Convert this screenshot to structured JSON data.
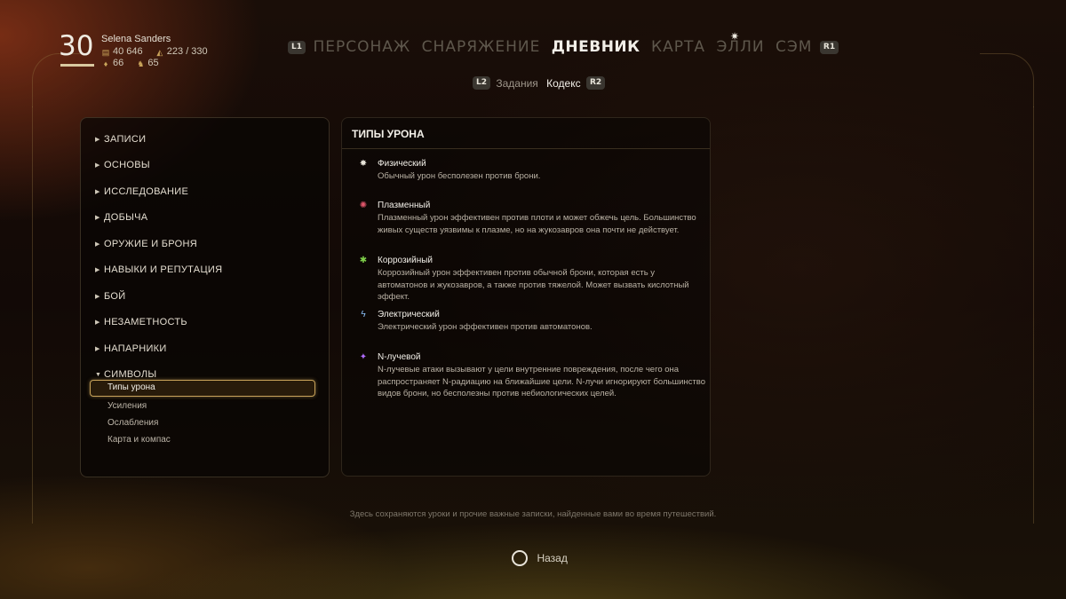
{
  "player": {
    "level": "30",
    "name": "Selena Sanders",
    "bits": "40 646",
    "carry": "223 / 330",
    "stat_a": "66",
    "stat_b": "65"
  },
  "tabs": {
    "hint_left": "L1",
    "hint_right": "R1",
    "items": [
      "ПЕРСОНАЖ",
      "СНАРЯЖЕНИЕ",
      "ДНЕВНИК",
      "КАРТА",
      "ЭЛЛИ",
      "СЭМ"
    ],
    "active": "ДНЕВНИК"
  },
  "subtabs": {
    "hint_left": "L2",
    "hint_right": "R2",
    "items": [
      "Задания",
      "Кодекс"
    ],
    "active": "Кодекс"
  },
  "categories": [
    "ЗАПИСИ",
    "ОСНОВЫ",
    "ИССЛЕДОВАНИЕ",
    "ДОБЫЧА",
    "ОРУЖИЕ И БРОНЯ",
    "НАВЫКИ И РЕПУТАЦИЯ",
    "БОЙ",
    "НЕЗАМЕТНОСТЬ",
    "НАПАРНИКИ",
    "СИМВОЛЫ"
  ],
  "subcategories": [
    "Типы урона",
    "Усиления",
    "Ослабления",
    "Карта и компас"
  ],
  "selected_subcategory": "Типы урона",
  "panel": {
    "title": "ТИПЫ УРОНА",
    "damage_types": [
      {
        "name": "Физический",
        "description": "Обычный урон бесполезен против брони.",
        "icon": "physical-icon",
        "color": "#e8e4da"
      },
      {
        "name": "Плазменный",
        "description": "Плазменный урон эффективен против плоти и может обжечь цель. Большинство живых существ уязвимы к плазме, но на жукозавров она почти не действует.",
        "icon": "plasma-icon",
        "color": "#e0566b"
      },
      {
        "name": "Коррозийный",
        "description": "Коррозийный урон эффективен против обычной брони, которая есть у автоматонов и жукозавров, а также против тяжелой. Может вызвать кислотный эффект.",
        "icon": "corrosive-icon",
        "color": "#7fd14a"
      },
      {
        "name": "Электрический",
        "description": "Электрический урон эффективен против автоматонов.",
        "icon": "shock-icon",
        "color": "#8fc6ff"
      },
      {
        "name": "N-лучевой",
        "description": "N-лучевые атаки вызывают у цели внутренние повреждения, после чего она распространяет N-радиацию на ближайшие цели. N-лучи игнорируют большинство видов брони, но бесполезны против небиологических целей.",
        "icon": "n-ray-icon",
        "color": "#b06cff"
      }
    ]
  },
  "footer": {
    "note": "Здесь сохраняются уроки и прочие важные записки, найденные вами во время путешествий.",
    "back_label": "Назад"
  }
}
